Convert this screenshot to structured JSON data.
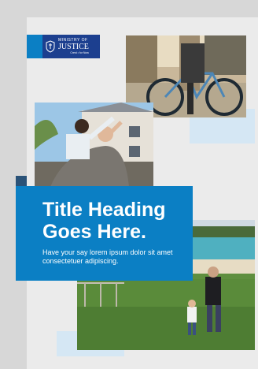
{
  "logo": {
    "line1": "MINISTRY OF",
    "line2": "JUSTICE",
    "line3": "Crest • for Now"
  },
  "hero": {
    "title_line1": "Title Heading",
    "title_line2": "Goes Here.",
    "body": "Have your say lorem ipsum dolor sit amet consectetuer adipiscing."
  },
  "colors": {
    "brand_blue": "#0b7fc4",
    "navy": "#1c3f8f",
    "light_blue": "#d5e7f4",
    "dark_bar": "#2a5278"
  }
}
